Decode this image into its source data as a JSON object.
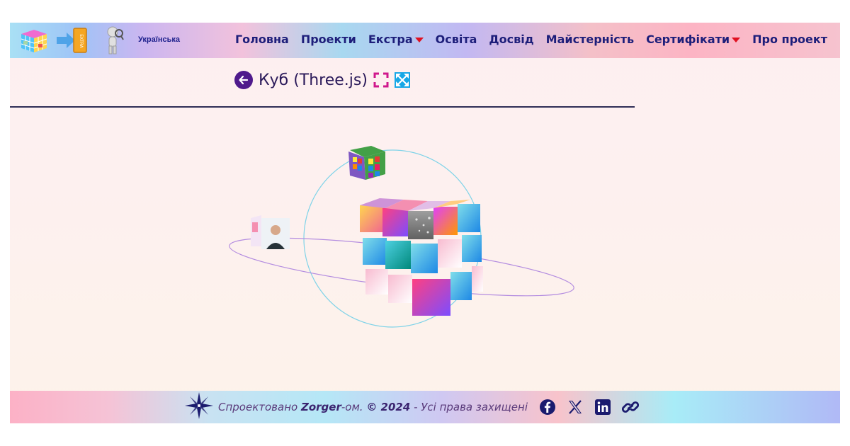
{
  "header": {
    "language_label": "Українська",
    "nav": [
      {
        "label": "Головна",
        "has_dropdown": false
      },
      {
        "label": "Проекти",
        "has_dropdown": false
      },
      {
        "label": "Екстра",
        "has_dropdown": true
      },
      {
        "label": "Освіта",
        "has_dropdown": false
      },
      {
        "label": "Досвід",
        "has_dropdown": false
      },
      {
        "label": "Майстерність",
        "has_dropdown": false
      },
      {
        "label": "Сертифікати",
        "has_dropdown": true
      },
      {
        "label": "Про проект",
        "has_dropdown": false
      }
    ],
    "logo_extra_text": "EXTRA"
  },
  "page": {
    "title": "Куб (Three.js)"
  },
  "footer": {
    "prefix": "Спроектовано ",
    "author": "Zorger",
    "author_suffix": "-ом. ",
    "copyright": "© 2024",
    "rights": " - Усі права захищені",
    "social": [
      "facebook-icon",
      "x-icon",
      "linkedin-icon",
      "link-icon"
    ]
  },
  "colors": {
    "nav_text": "#1d1e7a",
    "caret": "#e01020",
    "back_button": "#4f1a8c",
    "fullscreen_icon_1": "#d0188c",
    "fullscreen_icon_2": "#17a7e6"
  }
}
